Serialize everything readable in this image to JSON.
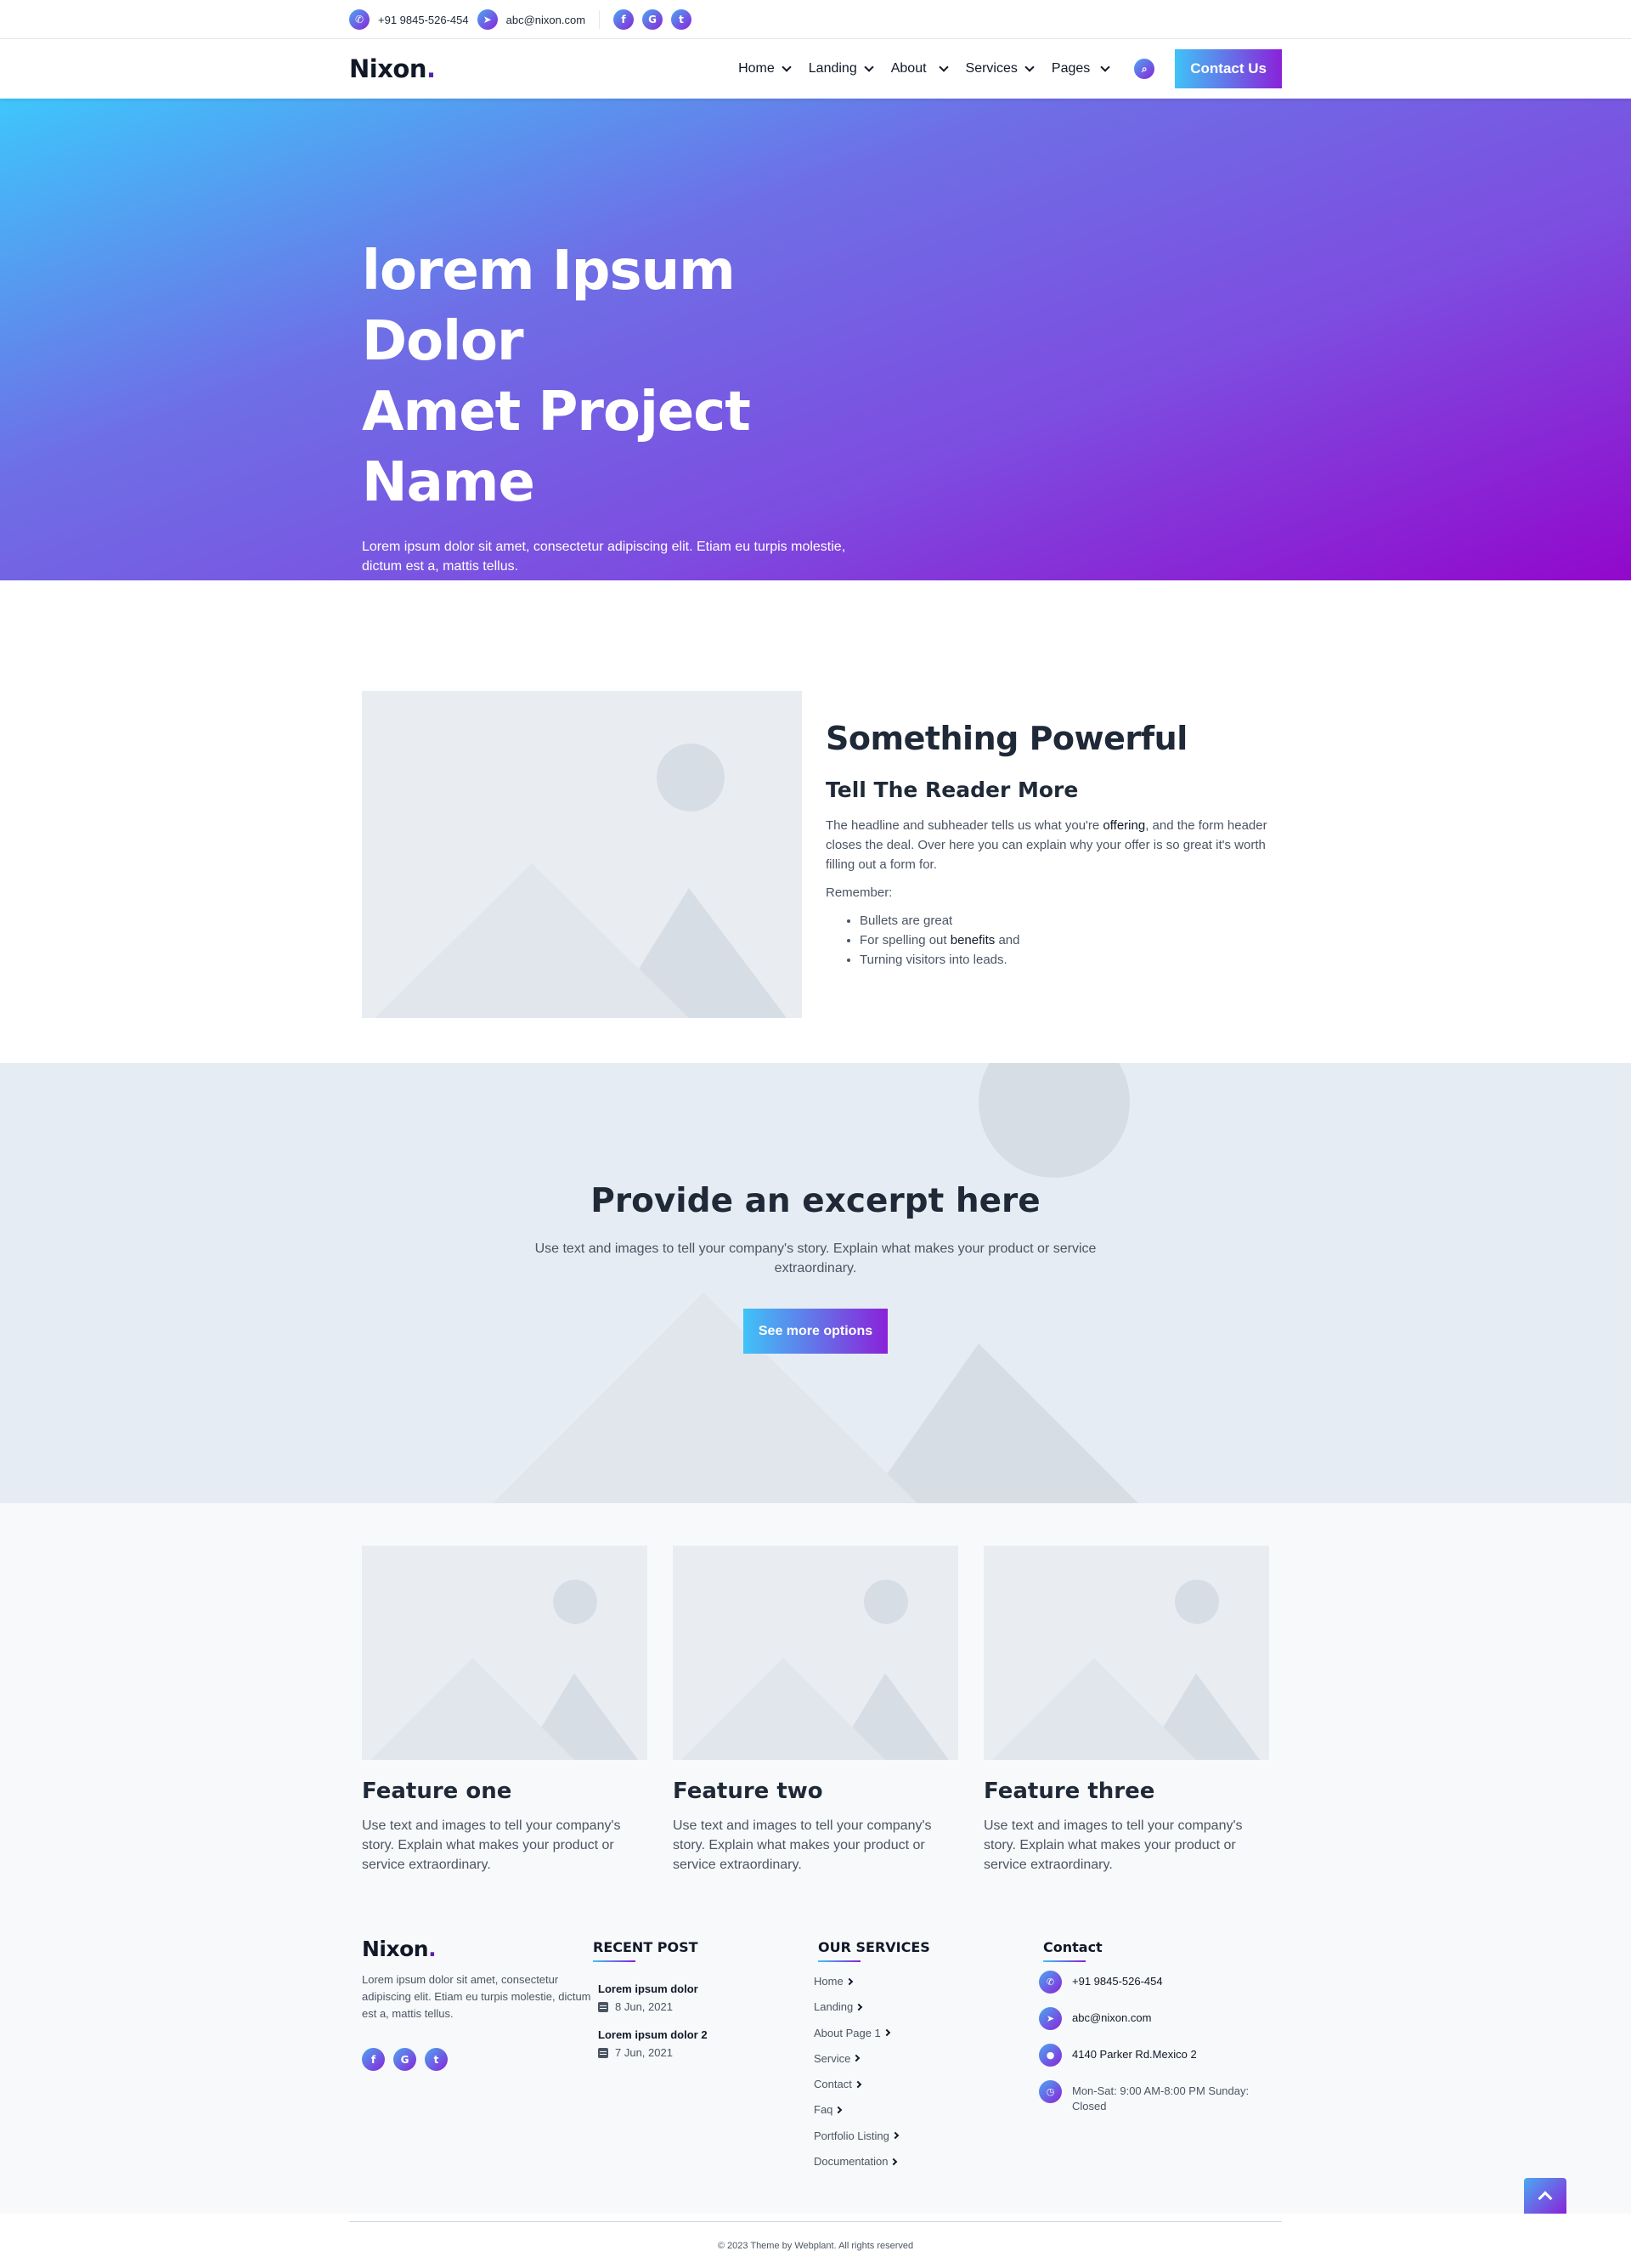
{
  "topbar": {
    "phone": "+91 9845-526-454",
    "email": "abc@nixon.com",
    "social": [
      "f",
      "G",
      "t"
    ]
  },
  "nav": {
    "logo": "Nixon",
    "logo_dot": ".",
    "items": [
      "Home",
      "Landing",
      "About",
      "Services",
      "Pages"
    ],
    "contact_label": "Contact Us"
  },
  "hero": {
    "title_line1": "lorem Ipsum Dolor",
    "title_line2": "Amet Project Name",
    "subtitle": "Lorem ipsum dolor sit amet, consectetur adipiscing elit. Etiam eu turpis molestie, dictum est a, mattis tellus."
  },
  "about": {
    "heading": "Something Powerful",
    "subheading": "Tell The Reader More",
    "para_before": "The headline and subheader tells us what you're ",
    "para_highlight": "offering",
    "para_after": ", and the form header closes the deal. Over here you can explain why your offer is so great it's worth filling out a form for.",
    "remember": "Remember:",
    "bullet1": "Bullets are great",
    "bullet2_before": "For spelling out ",
    "bullet2_highlight": "benefits",
    "bullet2_after": " and",
    "bullet3": "Turning visitors into leads."
  },
  "excerpt": {
    "heading": "Provide an excerpt here",
    "text": "Use text and images to tell your company's story. Explain what makes your product or service extraordinary.",
    "button": "See more options"
  },
  "features": [
    {
      "title": "Feature one",
      "text": "Use text and images to tell your company's story. Explain what makes your product or service extraordinary."
    },
    {
      "title": "Feature two",
      "text": "Use text and images to tell your company's story. Explain what makes your product or service extraordinary."
    },
    {
      "title": "Feature three",
      "text": "Use text and images to tell your company's story. Explain what makes your product or service extraordinary."
    }
  ],
  "footer": {
    "logo": "Nixon",
    "logo_dot": ".",
    "about": "Lorem ipsum dolor sit amet, consectetur adipiscing elit. Etiam eu turpis molestie, dictum est a, mattis tellus.",
    "social": [
      "f",
      "G",
      "t"
    ],
    "recent_heading": "RECENT POST",
    "posts": [
      {
        "title": "Lorem ipsum dolor",
        "date": "8 Jun, 2021"
      },
      {
        "title": "Lorem ipsum dolor 2",
        "date": "7 Jun, 2021"
      }
    ],
    "services_heading": "OUR SERVICES",
    "services": [
      "Home",
      "Landing",
      "About Page 1",
      "Service",
      "Contact",
      "Faq",
      "Portfolio Listing",
      "Documentation"
    ],
    "contact_heading": "Contact",
    "contact": {
      "phone": "+91 9845-526-454",
      "email": "abc@nixon.com",
      "address": "4140 Parker Rd.Mexico 2",
      "hours": "Mon-Sat: 9:00 AM-8:00 PM Sunday: Closed"
    },
    "copyright": "© 2023 Theme by Webplant. All rights reserved"
  },
  "colors": {
    "gradient_start": "#3fc3f7",
    "gradient_end": "#8a22d9",
    "placeholder_bg": "#e9edf2"
  },
  "icons": [
    "phone-icon",
    "telegram-icon",
    "facebook-icon",
    "google-icon",
    "twitter-icon",
    "search-icon",
    "calendar-icon",
    "location-icon",
    "clock-icon",
    "arrow-up-icon"
  ]
}
